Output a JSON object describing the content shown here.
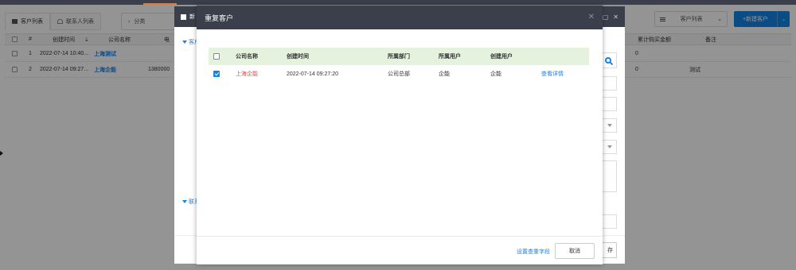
{
  "tabs": [
    {
      "label": "客户列表",
      "icon": "building-icon"
    },
    {
      "label": "联系人列表",
      "icon": "contacts-icon"
    }
  ],
  "filter_label": "分类",
  "view_select": "客户列表",
  "new_button": "+新建客户",
  "table": {
    "headers": [
      "#",
      "创建时间",
      "公司名称",
      "电",
      "累计购买金额",
      "备注"
    ],
    "rows": [
      {
        "num": "1",
        "time": "2022-07-14 10:40...",
        "company": "上海测试",
        "phone": "",
        "amount": "0",
        "note": ""
      },
      {
        "num": "2",
        "time": "2022-07-14 09:27...",
        "company": "上海企能",
        "phone": "1380000",
        "amount": "0",
        "note": "测试"
      }
    ]
  },
  "form_dialog": {
    "title_fragment": "新",
    "section1": "客户",
    "section2": "联系",
    "confirm_fragment": "存"
  },
  "dup_dialog": {
    "title": "重复客户",
    "headers": [
      "公司名称",
      "创建时间",
      "所属部门",
      "所属用户",
      "创建用户"
    ],
    "rows": [
      {
        "checked": true,
        "company": "上海企能",
        "created": "2022-07-14 09:27:20",
        "dept": "公司总部",
        "owner": "企能",
        "creator": "企能",
        "action": "查看详情"
      }
    ],
    "footer_link": "设置查重字段",
    "cancel": "取消"
  },
  "colors": {
    "header_dark": "#3a3f4b",
    "primary": "#1683e6",
    "table_head_green": "#e5f2dd",
    "company_red": "#e54545"
  }
}
